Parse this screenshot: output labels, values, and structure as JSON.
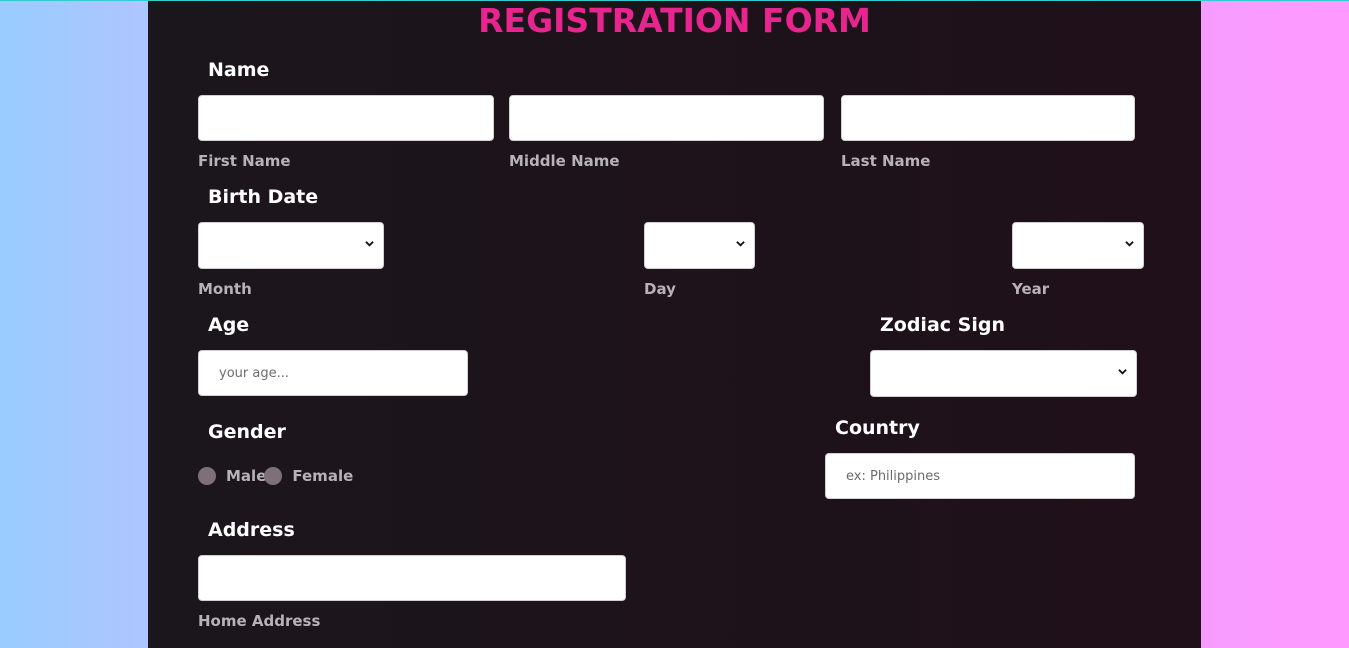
{
  "form": {
    "title": "REGISTRATION FORM",
    "name": {
      "label": "Name",
      "first_name_label": "First Name",
      "middle_name_label": "Middle Name",
      "last_name_label": "Last Name",
      "first_name_value": "",
      "middle_name_value": "",
      "last_name_value": ""
    },
    "birth_date": {
      "label": "Birth Date",
      "month_label": "Month",
      "day_label": "Day",
      "year_label": "Year"
    },
    "age": {
      "label": "Age",
      "placeholder": "your age..."
    },
    "zodiac": {
      "label": "Zodiac Sign"
    },
    "gender": {
      "label": "Gender",
      "options": [
        "Male",
        "Female"
      ]
    },
    "country": {
      "label": "Country",
      "placeholder": "ex: Philippines"
    },
    "address": {
      "label": "Address",
      "home_address_label": "Home Address"
    }
  },
  "colors": {
    "title": "#e8258f",
    "panel": "#1b161c",
    "label": "#ffffff",
    "sublabel": "#b7b2b9",
    "radio": "#7d7076"
  },
  "icons": {
    "select_chevron": "chevron-down-icon"
  }
}
